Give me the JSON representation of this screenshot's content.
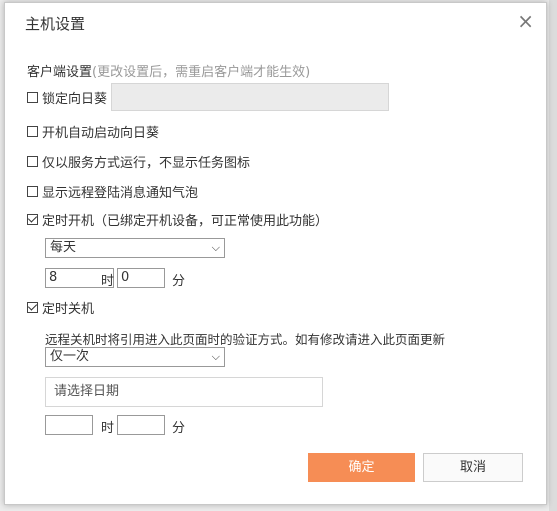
{
  "dialog": {
    "title": "主机设置",
    "close_glyph": "×"
  },
  "client_settings": {
    "heading": "客户端设置",
    "note": "(更改设置后，需重启客户端才能生效)"
  },
  "options": {
    "lock_sunflower": {
      "label": "锁定向日葵",
      "checked": false,
      "value": ""
    },
    "autostart": {
      "label": "开机自动启动向日葵",
      "checked": false
    },
    "service_only": {
      "label": "仅以服务方式运行，不显示任务图标",
      "checked": false
    },
    "login_notify": {
      "label": "显示远程登陆消息通知气泡",
      "checked": false
    }
  },
  "timed_power_on": {
    "label": "定时开机（已绑定开机设备，可正常使用此功能）",
    "checked": true,
    "frequency": "每天",
    "hour": "8",
    "hour_unit": "时",
    "minute": "0",
    "minute_unit": "分"
  },
  "timed_shutdown": {
    "label": "定时关机",
    "checked": true,
    "description": "远程关机时将引用进入此页面时的验证方式。如有修改请进入此页面更新",
    "frequency": "仅一次",
    "date_placeholder": "请选择日期",
    "hour": "",
    "hour_unit": "时",
    "minute": "",
    "minute_unit": "分"
  },
  "buttons": {
    "confirm": "确定",
    "cancel": "取消"
  },
  "icons": {
    "checkbox": "checkbox-icon",
    "dropdown": "chevron-down-icon",
    "close": "close-icon"
  },
  "colors": {
    "confirm_bg": "#f68d55",
    "disabled_field_bg": "#ebebeb"
  }
}
